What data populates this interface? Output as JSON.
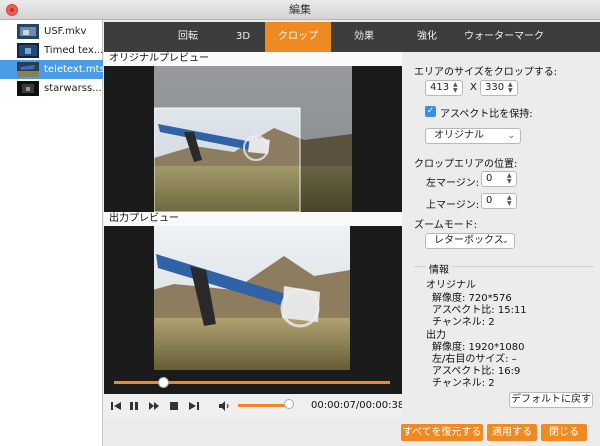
{
  "window": {
    "title": "編集"
  },
  "sidebar": {
    "files": [
      {
        "name": "USF.mkv",
        "selected": false
      },
      {
        "name": "Timed tex...",
        "selected": false
      },
      {
        "name": "teletext.mts",
        "selected": true
      },
      {
        "name": "starwarss...",
        "selected": false
      }
    ]
  },
  "tabs": [
    {
      "label": "回転",
      "active": false
    },
    {
      "label": "3D",
      "active": false
    },
    {
      "label": "クロップ",
      "active": true
    },
    {
      "label": "効果",
      "active": false
    },
    {
      "label": "強化",
      "active": false
    },
    {
      "label": "ウォーターマーク",
      "active": false
    }
  ],
  "preview": {
    "original_label": "オリジナルプレビュー",
    "output_label": "出力プレビュー",
    "time": "00:00:07/00:00:38",
    "progress_fraction": 0.18,
    "volume_fraction": 0.9
  },
  "crop": {
    "area_size_label": "エリアのサイズをクロップする:",
    "width": "413",
    "height": "330",
    "x_sep": "X",
    "keep_aspect_label": "アスペクト比を保持:",
    "keep_aspect_checked": true,
    "aspect_value": "オリジナル",
    "position_label": "クロップエリアの位置:",
    "left_margin_label": "左マージン:",
    "left_margin": "0",
    "top_margin_label": "上マージン:",
    "top_margin": "0",
    "zoom_label": "ズームモード:",
    "zoom_value": "レターボックス"
  },
  "info": {
    "title": "情報",
    "original_heading": "オリジナル",
    "original_resolution": "解像度: 720*576",
    "original_aspect": "アスペクト比: 15:11",
    "original_channels": "チャンネル: 2",
    "output_heading": "出力",
    "output_resolution": "解像度: 1920*1080",
    "output_lr_size": "左/右目のサイズ: –",
    "output_aspect": "アスペクト比: 16:9",
    "output_channels": "チャンネル: 2"
  },
  "buttons": {
    "reset_default": "デフォルトに戻す",
    "restore_all": "すべてを復元する",
    "apply": "適用する",
    "close": "閉じる"
  },
  "colors": {
    "accent": "#ef8a22",
    "selection": "#4a9ce6",
    "tabbar": "#3d3d3d",
    "check": "#3b8ee8"
  }
}
